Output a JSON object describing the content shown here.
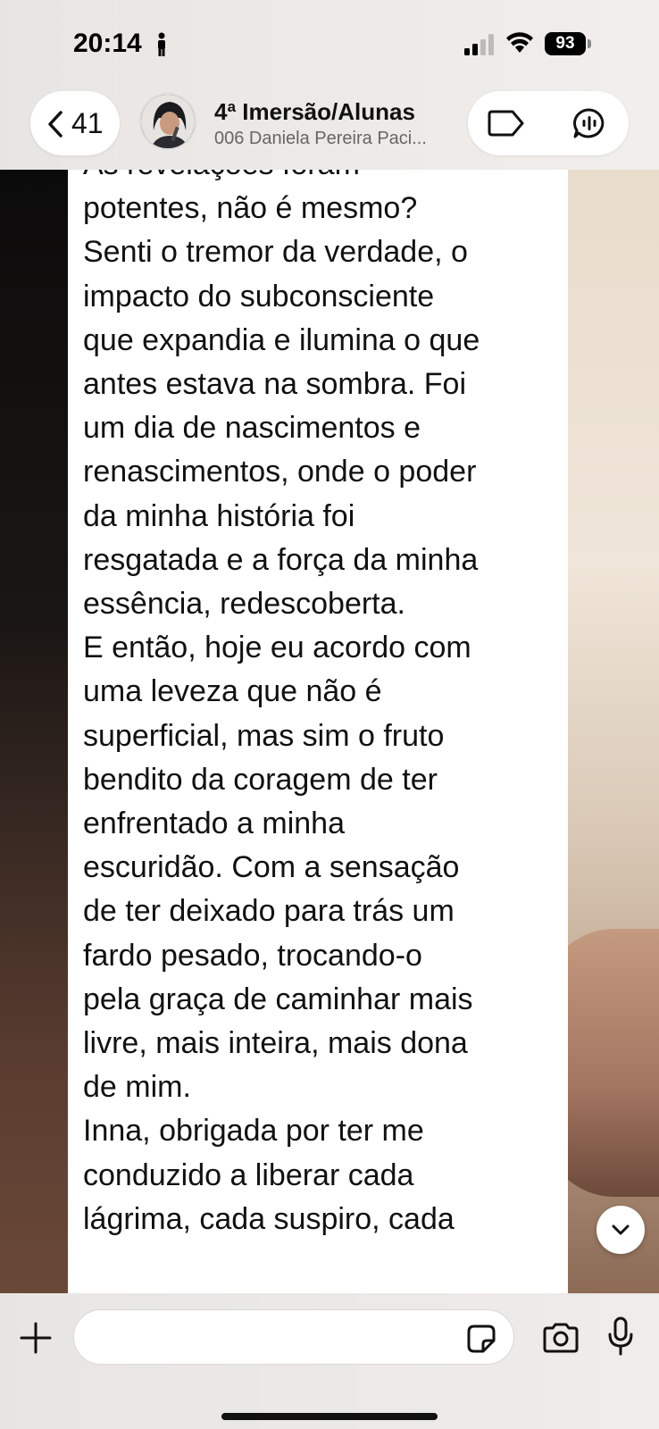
{
  "status_bar": {
    "time": "20:14",
    "battery": "93"
  },
  "header": {
    "back_count": "41",
    "group_title": "4ª Imersão/Alunas",
    "group_subtitle": "006 Daniela Pereira Paci..."
  },
  "message": {
    "text": "As revelações foram\npotentes, não é mesmo?\nSenti o tremor da verdade, o\nimpacto do subconsciente\nque expandia e ilumina o que\nantes estava na sombra. Foi\num dia de nascimentos e\nrenascimentos, onde o poder\nda minha história foi\nresgatada e a força da minha\nessência, redescoberta.\nE então, hoje eu acordo com\numa leveza que não é\nsuperficial, mas sim o fruto\nbendito da coragem de ter\nenfrentado a minha\nescuridão. Com a sensação\nde ter deixado para trás um\nfardo pesado, trocando-o\npela graça de caminhar mais\nlivre, mais inteira, mais dona\nde mim.\nInna, obrigada por ter me\nconduzido a liberar cada\nlágrima, cada suspiro, cada"
  },
  "composer": {
    "value": "",
    "placeholder": ""
  },
  "icons": {
    "back": "chevron-left-icon",
    "label": "label-tag-icon",
    "voice_chat": "voice-chat-icon",
    "scroll_down": "chevron-down-icon",
    "attach": "plus-icon",
    "sticker": "sticker-icon",
    "camera": "camera-icon",
    "mic": "microphone-icon"
  }
}
